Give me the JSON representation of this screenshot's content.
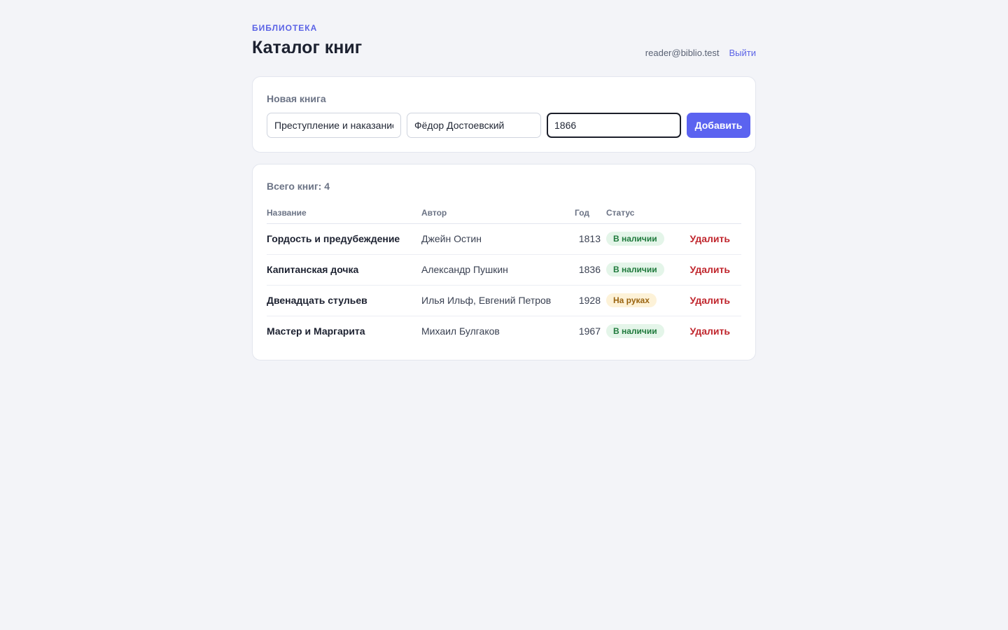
{
  "header": {
    "eyebrow": "Библиотека",
    "title": "Каталог книг",
    "user_email": "reader@biblio.test",
    "logout_label": "Выйти"
  },
  "form": {
    "title": "Новая книга",
    "title_value": "Преступление и наказание",
    "author_value": "Фёдор Достоевский",
    "year_value": "1866",
    "submit_label": "Добавить"
  },
  "list": {
    "summary": "Всего книг: 4",
    "columns": {
      "title": "Название",
      "author": "Автор",
      "year": "Год",
      "status": "Статус"
    },
    "delete_label": "Удалить",
    "rows": [
      {
        "title": "Гордость и предубеждение",
        "author": "Джейн Остин",
        "year": "1813",
        "status": "В наличии",
        "status_kind": "available"
      },
      {
        "title": "Капитанская дочка",
        "author": "Александр Пушкин",
        "year": "1836",
        "status": "В наличии",
        "status_kind": "available"
      },
      {
        "title": "Двенадцать стульев",
        "author": "Илья Ильф, Евгений Петров",
        "year": "1928",
        "status": "На руках",
        "status_kind": "borrowed"
      },
      {
        "title": "Мастер и Маргарита",
        "author": "Михаил Булгаков",
        "year": "1967",
        "status": "В наличии",
        "status_kind": "available"
      }
    ]
  },
  "colors": {
    "accent": "#5b63f0",
    "danger": "#c0262d",
    "available_bg": "#e4f5e9",
    "available_fg": "#1f7a3c",
    "borrowed_bg": "#fdf2d8",
    "borrowed_fg": "#9a6410"
  }
}
